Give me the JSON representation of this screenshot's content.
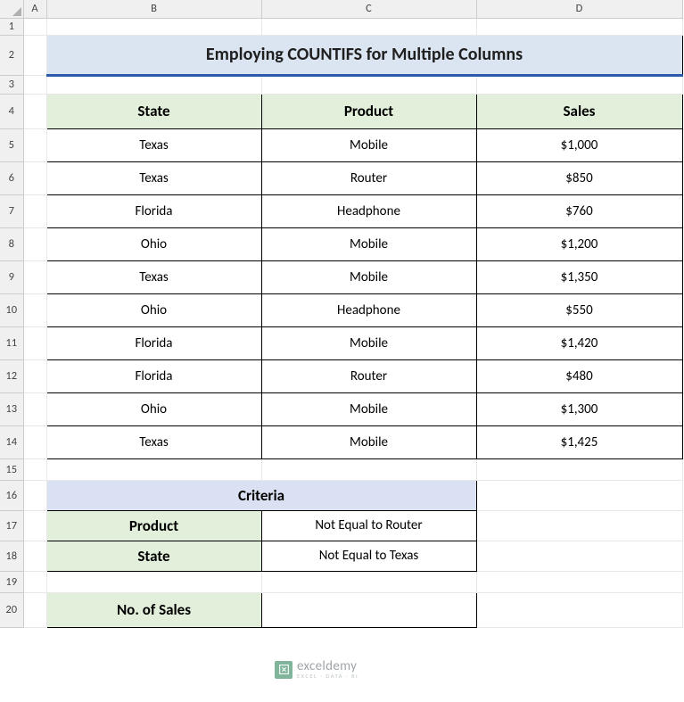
{
  "columns": [
    "A",
    "B",
    "C",
    "D"
  ],
  "rows": [
    "1",
    "2",
    "3",
    "4",
    "5",
    "6",
    "7",
    "8",
    "9",
    "10",
    "11",
    "12",
    "13",
    "14",
    "15",
    "16",
    "17",
    "18",
    "19",
    "20"
  ],
  "title": "Employing COUNTIFS for Multiple Columns",
  "table": {
    "headers": [
      "State",
      "Product",
      "Sales"
    ],
    "rows": [
      {
        "state": "Texas",
        "product": "Mobile",
        "sales": "$1,000"
      },
      {
        "state": "Texas",
        "product": "Router",
        "sales": "$850"
      },
      {
        "state": "Florida",
        "product": "Headphone",
        "sales": "$760"
      },
      {
        "state": "Ohio",
        "product": "Mobile",
        "sales": "$1,200"
      },
      {
        "state": "Texas",
        "product": "Mobile",
        "sales": "$1,350"
      },
      {
        "state": "Ohio",
        "product": "Headphone",
        "sales": "$550"
      },
      {
        "state": "Florida",
        "product": "Mobile",
        "sales": "$1,420"
      },
      {
        "state": "Florida",
        "product": "Router",
        "sales": "$480"
      },
      {
        "state": "Ohio",
        "product": "Mobile",
        "sales": "$1,300"
      },
      {
        "state": "Texas",
        "product": "Mobile",
        "sales": "$1,425"
      }
    ]
  },
  "criteria": {
    "title": "Criteria",
    "rows": [
      {
        "label": "Product",
        "value": "Not Equal to Router"
      },
      {
        "label": "State",
        "value": "Not Equal to Texas"
      }
    ]
  },
  "result": {
    "label": "No. of Sales",
    "value": ""
  },
  "watermark": {
    "main": "exceldemy",
    "sub": "EXCEL · DATA · BI"
  }
}
